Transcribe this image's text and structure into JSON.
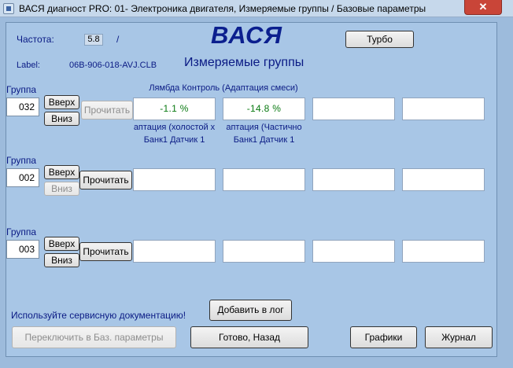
{
  "window": {
    "title": "ВАСЯ диагност PRO: 01- Электроника двигателя,  Измеряемые группы / Базовые параметры",
    "close_glyph": "✕"
  },
  "header": {
    "freq_label": "Частота:",
    "freq_value": "5.8",
    "freq_sep": "/",
    "label_label": "Label:",
    "label_value": "06B-906-018-AVJ.CLB",
    "brand": "ВАСЯ",
    "section_title": "Измеряемые группы",
    "turbo_button": "Турбо"
  },
  "groups": [
    {
      "label": "Группа",
      "number": "032",
      "up": "Вверх",
      "down": "Вниз",
      "read": "Прочитать",
      "title": "Лямбда Контроль (Адаптация смеси)",
      "values": [
        "-1.1 %",
        "-14.8 %",
        "",
        ""
      ],
      "sub1": [
        "аптация (холостой х",
        "аптация (Частично"
      ],
      "sub2": [
        "Банк1 Датчик 1",
        "Банк1 Датчик 1"
      ]
    },
    {
      "label": "Группа",
      "number": "002",
      "up": "Вверх",
      "down": "Вниз",
      "read": "Прочитать",
      "values": [
        "",
        "",
        "",
        ""
      ]
    },
    {
      "label": "Группа",
      "number": "003",
      "up": "Вверх",
      "down": "Вниз",
      "read": "Прочитать",
      "values": [
        "",
        "",
        "",
        ""
      ]
    }
  ],
  "footer": {
    "service_note": "Используйте сервисную документацию!",
    "add_log": "Добавить в лог",
    "switch_basic": "Переключить в Баз. параметры",
    "done_back": "Готово, Назад",
    "graphs": "Графики",
    "journal": "Журнал"
  }
}
